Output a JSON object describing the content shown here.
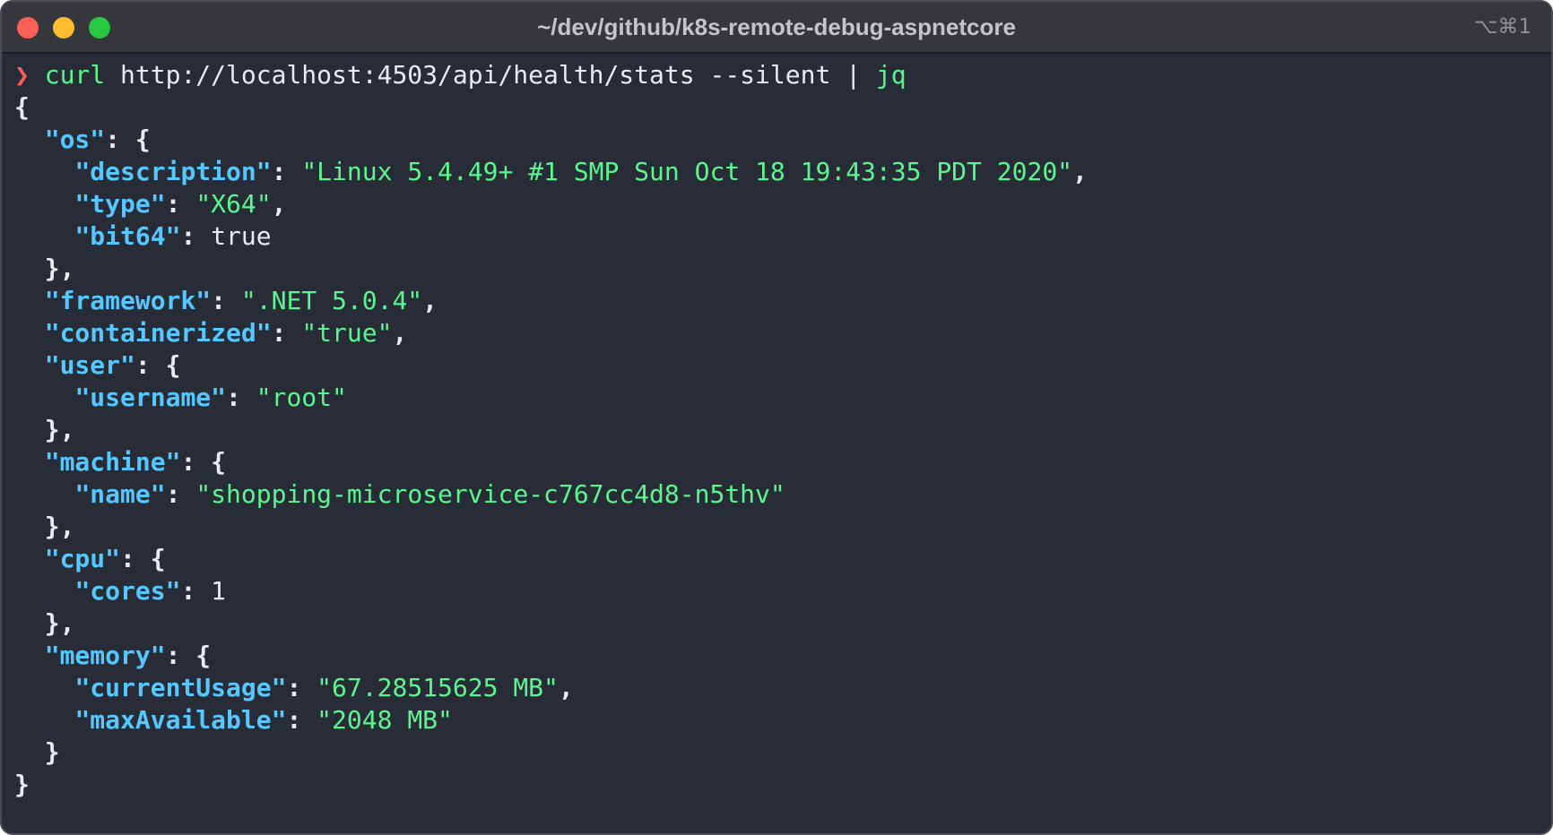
{
  "window": {
    "title": "~/dev/github/k8s-remote-debug-aspnetcore",
    "shortcut": "⌥⌘1"
  },
  "colors": {
    "background": "#282c37",
    "titlebar": "#35373d",
    "key": "#57c7ff",
    "string": "#5af78e",
    "prompt": "#ff5c57",
    "text": "#e9ebee"
  },
  "terminal": {
    "prompt": "❯",
    "command": "curl",
    "url": "http://localhost:4503/api/health/stats",
    "flag": "--silent",
    "pipe": "|",
    "filter": "jq",
    "output": {
      "os_key": "\"os\"",
      "description_key": "\"description\"",
      "description_value": "\"Linux 5.4.49+ #1 SMP Sun Oct 18 19:43:35 PDT 2020\"",
      "type_key": "\"type\"",
      "type_value": "\"X64\"",
      "bit64_key": "\"bit64\"",
      "bit64_value": "true",
      "framework_key": "\"framework\"",
      "framework_value": "\".NET 5.0.4\"",
      "containerized_key": "\"containerized\"",
      "containerized_value": "\"true\"",
      "user_key": "\"user\"",
      "username_key": "\"username\"",
      "username_value": "\"root\"",
      "machine_key": "\"machine\"",
      "name_key": "\"name\"",
      "name_value": "\"shopping-microservice-c767cc4d8-n5thv\"",
      "cpu_key": "\"cpu\"",
      "cores_key": "\"cores\"",
      "cores_value": "1",
      "memory_key": "\"memory\"",
      "currentUsage_key": "\"currentUsage\"",
      "currentUsage_value": "\"67.28515625 MB\"",
      "maxAvailable_key": "\"maxAvailable\"",
      "maxAvailable_value": "\"2048 MB\""
    }
  }
}
